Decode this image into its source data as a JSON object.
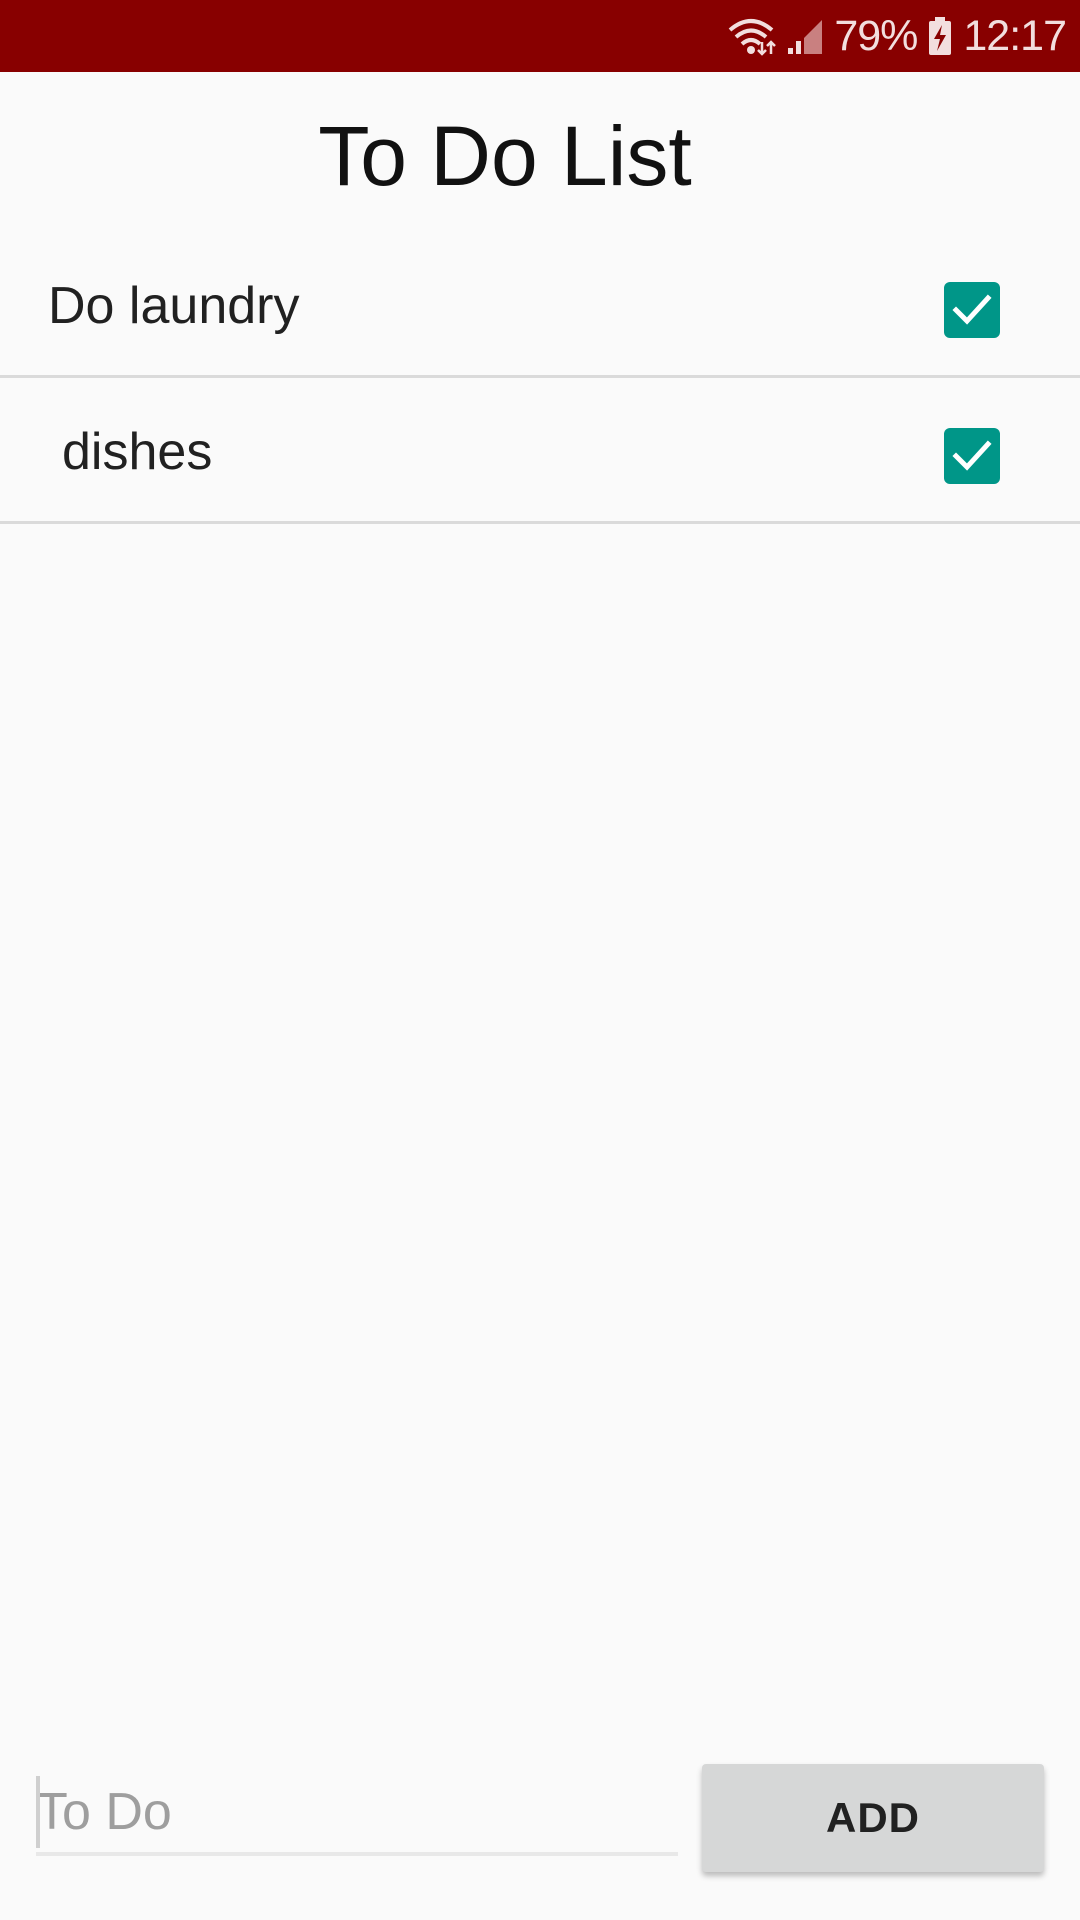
{
  "status_bar": {
    "battery_percent": "79%",
    "time": "12:17",
    "background_color": "#880000",
    "icons": [
      "wifi-icon",
      "signal-icon",
      "battery-charging-icon"
    ]
  },
  "app": {
    "title": "To Do List"
  },
  "todos": [
    {
      "label": "Do laundry",
      "checked": true
    },
    {
      "label": "dishes",
      "checked": true
    }
  ],
  "input": {
    "placeholder": "To Do",
    "value": ""
  },
  "add_button": {
    "label": "ADD"
  },
  "colors": {
    "accent": "#009688",
    "button_bg": "#d6d7d7"
  }
}
